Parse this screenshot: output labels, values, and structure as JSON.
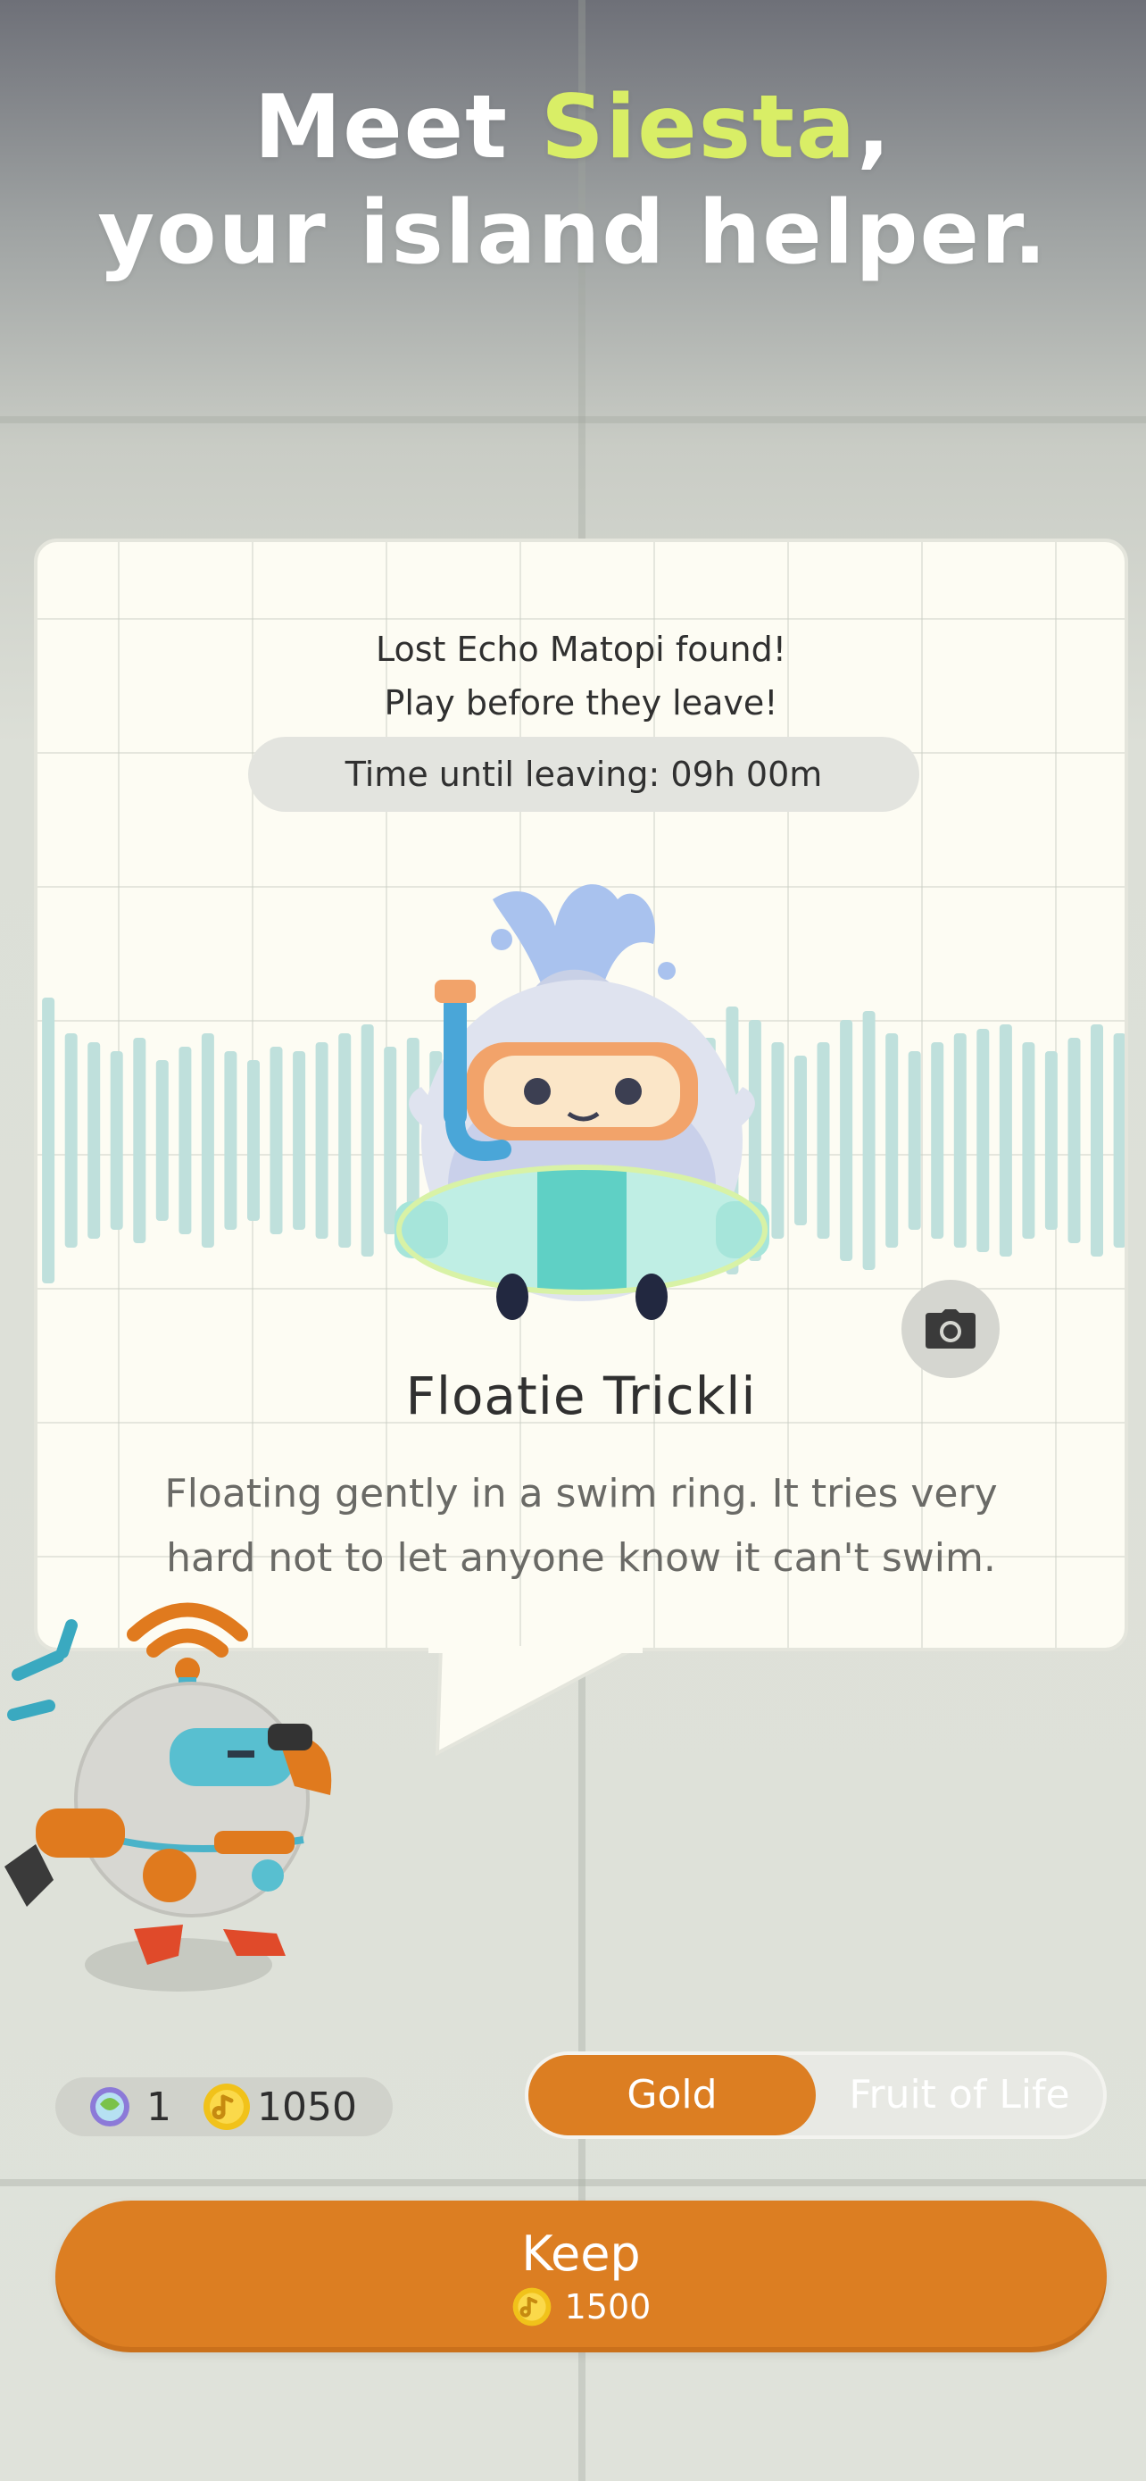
{
  "headline": {
    "line1_prefix": "Meet ",
    "name": "Siesta",
    "line1_suffix": ",",
    "line2": "your island helper."
  },
  "card": {
    "found_line1": "Lost Echo Matopi found!",
    "found_line2": "Play before they leave!",
    "timer": "Time until leaving: 09h 00m",
    "creature_name": "Floatie Trickli",
    "description": "Floating gently in a swim ring. It tries very hard not to let anyone know it can't swim.",
    "camera_icon": "camera-icon"
  },
  "currency": {
    "gem_count": "1",
    "coin_count": "1050"
  },
  "toggle": {
    "gold_label": "Gold",
    "fruit_label": "Fruit of Life",
    "selected": "Gold"
  },
  "keep_button": {
    "label": "Keep",
    "price": "1500"
  },
  "colors": {
    "accent_orange": "#dc7e22",
    "highlight_green": "#d9ee66",
    "card_bg": "#fdfcf3",
    "wave_teal": "#bfe0dc"
  }
}
